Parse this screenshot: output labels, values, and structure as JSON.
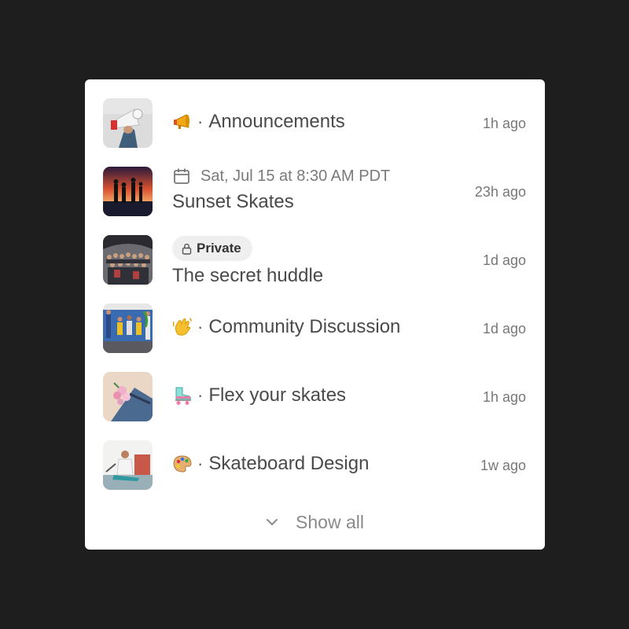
{
  "channels": [
    {
      "emoji": "megaphone-emoji",
      "title": "Announcements",
      "time": "1h ago"
    },
    {
      "date": "Sat, Jul 15 at 8:30 AM PDT",
      "title": "Sunset Skates",
      "time": "23h ago"
    },
    {
      "badge": "Private",
      "title": "The secret huddle",
      "time": "1d ago"
    },
    {
      "emoji": "waving-hand-emoji",
      "title": "Community Discussion",
      "time": "1d ago"
    },
    {
      "emoji": "roller-skate-emoji",
      "title": "Flex your skates",
      "time": "1h ago"
    },
    {
      "emoji": "artist-palette-emoji",
      "title": "Skateboard Design",
      "time": "1w ago"
    }
  ],
  "separator": "·",
  "show_all_label": "Show all",
  "colors": {
    "background": "#1e1e1e",
    "card": "#ffffff",
    "text": "#4a4a4a",
    "muted": "#777777",
    "pill": "#efefef"
  }
}
